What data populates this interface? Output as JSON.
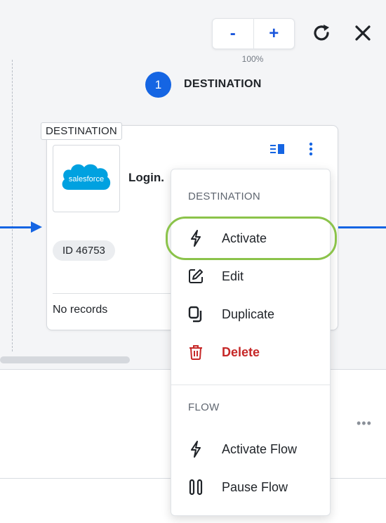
{
  "zoom": {
    "minus_label": "-",
    "plus_label": "+",
    "level": "100%"
  },
  "toolbar_icons": {
    "refresh": "refresh-icon",
    "close": "close-icon"
  },
  "step": {
    "number": "1",
    "title": "DESTINATION"
  },
  "card": {
    "type_tag": "DESTINATION",
    "logo_text": "salesforce",
    "name": "Login.",
    "id_label": "ID 46753",
    "records_text": "No records"
  },
  "menu": {
    "destination_section": "DESTINATION",
    "flow_section": "FLOW",
    "items": [
      {
        "label": "Activate",
        "icon": "bolt-icon"
      },
      {
        "label": "Edit",
        "icon": "edit-icon"
      },
      {
        "label": "Duplicate",
        "icon": "duplicate-icon"
      },
      {
        "label": "Delete",
        "icon": "trash-icon"
      }
    ],
    "flow_items": [
      {
        "label": "Activate Flow",
        "icon": "bolt-icon"
      },
      {
        "label": "Pause Flow",
        "icon": "pause-icon"
      }
    ]
  },
  "page_more": "•••",
  "colors": {
    "accent": "#1565e3",
    "danger": "#c62828",
    "highlight": "#8bc34a",
    "salesforce_blue": "#00a1e0"
  }
}
